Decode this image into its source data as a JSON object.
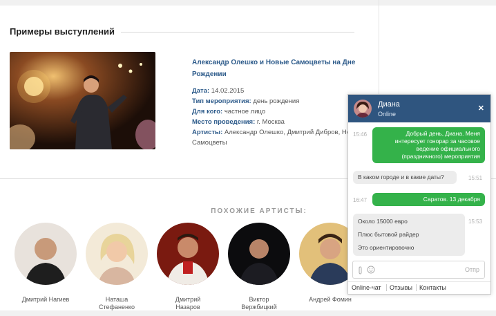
{
  "section": {
    "title": "Примеры выступлений"
  },
  "event": {
    "title": "Александр Олешко и Новые Самоцветы на Дне Рождении",
    "date_label": "Дата:",
    "date": "14.02.2015",
    "type_label": "Тип мероприятия:",
    "type": "день рождения",
    "for_label": "Для кого:",
    "for": "частное лицо",
    "place_label": "Место проведения:",
    "place": "г. Москва",
    "artists_label": "Артисты:",
    "artists": "Александр Олешко, Дмитрий Дибров, Новые Самоцветы"
  },
  "similar": {
    "title": "ПОХОЖИЕ АРТИСТЫ:",
    "artists": [
      {
        "name1": "Дмитрий Нагиев",
        "name2": ""
      },
      {
        "name1": "Наташа",
        "name2": "Стефаненко"
      },
      {
        "name1": "Дмитрий",
        "name2": "Назаров"
      },
      {
        "name1": "Виктор",
        "name2": "Верж­бицкий"
      },
      {
        "name1": "Андрей Фомин",
        "name2": ""
      }
    ]
  },
  "chat": {
    "operator_name": "Диана",
    "operator_status": "Online",
    "messages": [
      {
        "time": "15:46",
        "text": "Добрый день, Диана. Меня интересует гонорар за часовое ведение официального (праздничного) мероприятия"
      },
      {
        "time": "15:51",
        "text": "В каком городе и в какие даты?"
      },
      {
        "time": "16:47",
        "text": "Саратов. 13 декабря"
      },
      {
        "time": "15:53",
        "line1": "Около 15000 евро",
        "line2": "Плюс бытовой райдер",
        "line3": "Это ориентировочно"
      }
    ],
    "send_label": "Отпр",
    "tabs": [
      "Online-чат",
      "Отзывы",
      "Контакты"
    ]
  }
}
